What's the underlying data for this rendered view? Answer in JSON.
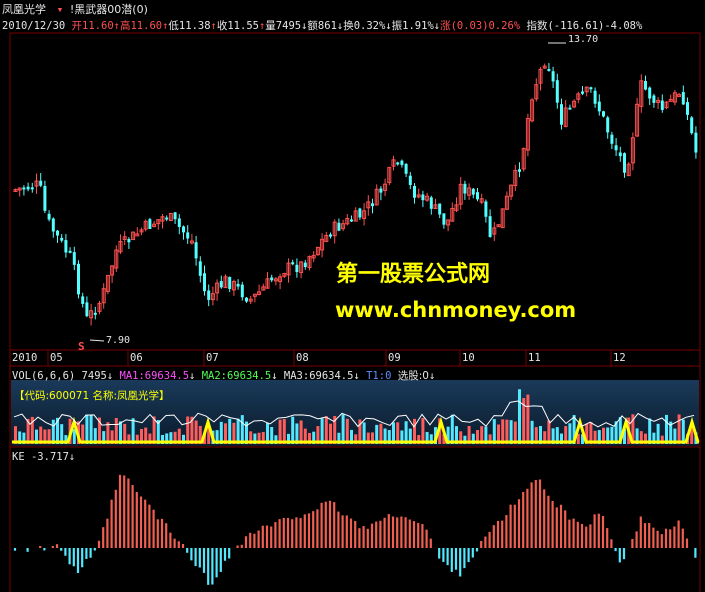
{
  "header": {
    "stock_name": "凤凰光学",
    "indicator_name": "!黑武器00",
    "indicator_param": "潜(0)"
  },
  "quote": {
    "date": "2010/12/30",
    "open_label": "开",
    "open": "11.60",
    "high_label": "高",
    "high": "11.60",
    "low_label": "低",
    "low": "11.38",
    "close_label": "收",
    "close": "11.55",
    "volume_label": "量",
    "volume": "7495",
    "amount_label": "额",
    "amount": "861",
    "turnover_label": "换",
    "turnover": "0.32%",
    "amplitude_label": "振",
    "amplitude": "1.91%",
    "change_label": "涨",
    "change": "(0.03)0.26%",
    "index_label": "指数",
    "index": "(-116.61)-4.08%"
  },
  "annotations": {
    "max_price": "13.70",
    "min_price": "7.90",
    "sell_marker": "S"
  },
  "watermark": {
    "line1": "第一股票公式网",
    "line2": "www.chnmoney.com"
  },
  "time_axis": {
    "labels": [
      "2010",
      "05",
      "06",
      "07",
      "08",
      "09",
      "10",
      "11",
      "12"
    ]
  },
  "vol_panel": {
    "title": "VOL(6,6,6)",
    "vol": "7495",
    "ma1": "MA1:69634.5",
    "ma2": "MA2:69634.5",
    "ma3": "MA3:69634.5",
    "t1": "T1:0",
    "select": "选股:0",
    "code_note": "【代码:600071 名称:凤凰光学】"
  },
  "ke_panel": {
    "title": "KE",
    "value": "-3.717"
  },
  "colors": {
    "up": "#ff5050",
    "down": "#54ffff",
    "grid": "#7a0000",
    "text_yellow": "#ffff00"
  }
}
